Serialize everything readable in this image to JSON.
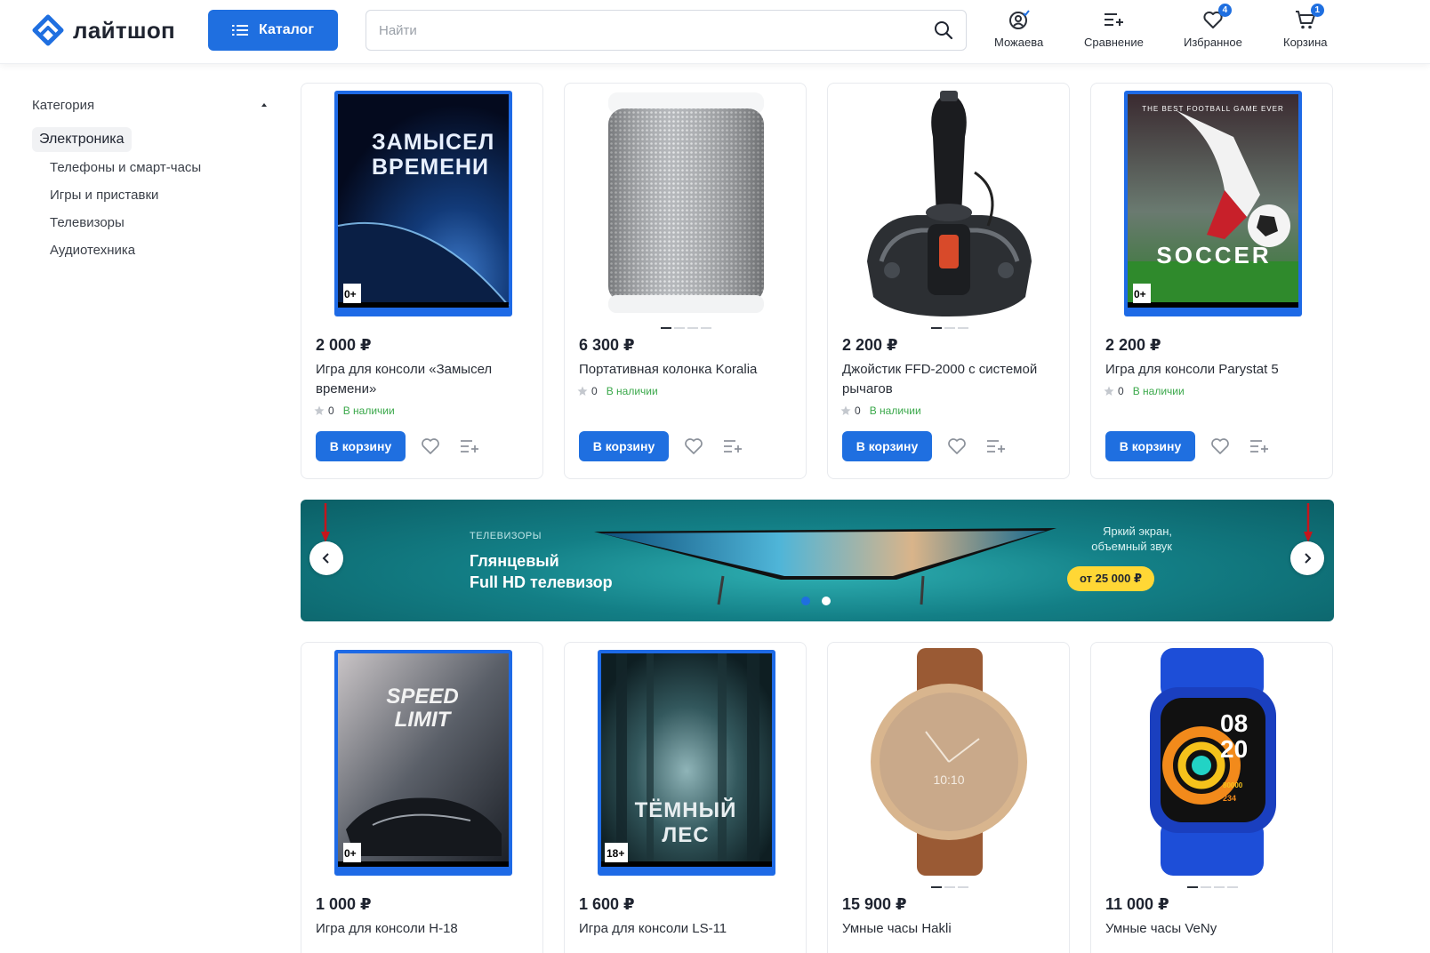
{
  "header": {
    "logo_text": "лайтшоп",
    "catalog_label": "Каталог",
    "search_placeholder": "Найти",
    "items": [
      {
        "label": "Можаева",
        "icon": "user-icon",
        "badge": ""
      },
      {
        "label": "Сравнение",
        "icon": "compare-icon",
        "badge": ""
      },
      {
        "label": "Избранное",
        "icon": "heart-icon",
        "badge": "4"
      },
      {
        "label": "Корзина",
        "icon": "cart-icon",
        "badge": "1"
      }
    ]
  },
  "sidebar": {
    "title": "Категория",
    "active": "Электроника",
    "items": [
      "Телефоны и смарт-часы",
      "Игры и приставки",
      "Телевизоры",
      "Аудиотехника"
    ]
  },
  "products": [
    {
      "price": "2 000 ₽",
      "title": "Игра для консоли «Замысел времени»",
      "rating": "0",
      "stock": "В наличии",
      "cover_text": "ЗАМЫСЕЛ ВРЕМЕНИ",
      "age": "0+"
    },
    {
      "price": "6 300 ₽",
      "title": "Портативная колонка Koralia",
      "rating": "0",
      "stock": "В наличии"
    },
    {
      "price": "2 200 ₽",
      "title": "Джойстик FFD-2000 с системой рычагов",
      "rating": "0",
      "stock": "В наличии"
    },
    {
      "price": "2 200 ₽",
      "title": "Игра для консоли Parystat 5",
      "rating": "0",
      "stock": "В наличии",
      "cover_text": "SOCCER",
      "cover_sub": "THE BEST FOOTBALL GAME EVER",
      "age": "0+"
    },
    {
      "price": "1 000 ₽",
      "title": "Игра для консоли H-18",
      "cover_text": "SPEED LIMIT",
      "age": "0+"
    },
    {
      "price": "1 600 ₽",
      "title": "Игра для консоли LS-11",
      "cover_text": "ТЁМНЫЙ ЛЕС",
      "age": "18+"
    },
    {
      "price": "15 900 ₽",
      "title": "Умные часы Hakli",
      "watch_time": "10:10"
    },
    {
      "price": "11 000 ₽",
      "title": "Умные часы VeNy",
      "watch_time": "08 20",
      "watch_steps": "80000",
      "watch_kcal": "234"
    }
  ],
  "buttons": {
    "cart_label": "В корзину"
  },
  "banner": {
    "category": "ТЕЛЕВИЗОРЫ",
    "title": "Глянцевый\nFull HD телевизор",
    "side_text": "Яркий экран,\nобъемный звук",
    "price_label": "от 25 000 ₽"
  },
  "colors": {
    "accent": "#1f6fe0",
    "stock": "#3aa84a",
    "banner": "#137f86",
    "price_pill": "#ffd735"
  }
}
